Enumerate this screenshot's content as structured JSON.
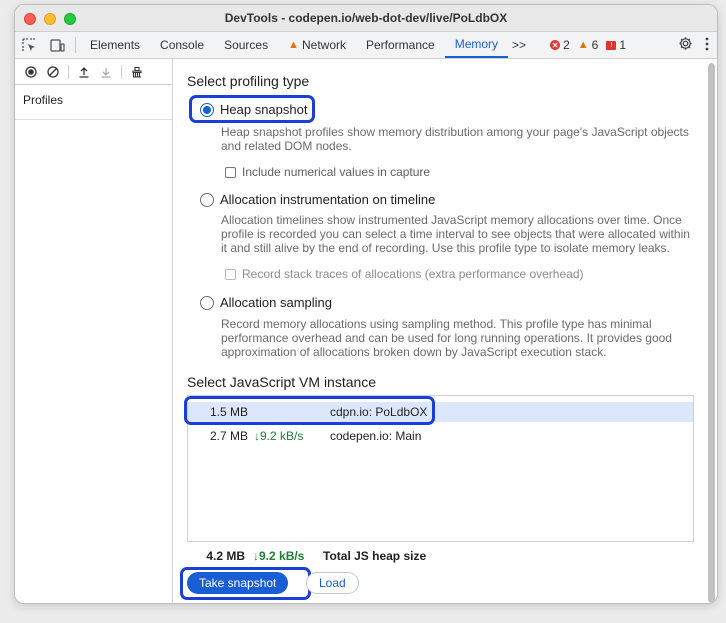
{
  "window": {
    "title": "DevTools - codepen.io/web-dot-dev/live/PoLdbOX"
  },
  "toolbar": {
    "tabs": [
      {
        "label": "Elements"
      },
      {
        "label": "Console"
      },
      {
        "label": "Sources"
      },
      {
        "label": "Network",
        "warning": true
      },
      {
        "label": "Performance"
      },
      {
        "label": "Memory",
        "active": true
      }
    ],
    "more_label": ">>",
    "errors": "2",
    "warnings": "6",
    "issues": "1"
  },
  "sidebar": {
    "section": "Profiles"
  },
  "profiling": {
    "heading": "Select profiling type",
    "options": [
      {
        "label": "Heap snapshot",
        "checked": true,
        "description": "Heap snapshot profiles show memory distribution among your page's JavaScript objects and related DOM nodes.",
        "checkbox": "Include numerical values in capture"
      },
      {
        "label": "Allocation instrumentation on timeline",
        "checked": false,
        "description": "Allocation timelines show instrumented JavaScript memory allocations over time. Once profile is recorded you can select a time interval to see objects that were allocated within it and still alive by the end of recording. Use this profile type to isolate memory leaks.",
        "checkbox": "Record stack traces of allocations (extra performance overhead)"
      },
      {
        "label": "Allocation sampling",
        "checked": false,
        "description": "Record memory allocations using sampling method. This profile type has minimal performance overhead and can be used for long running operations. It provides good approximation of allocations broken down by JavaScript execution stack."
      }
    ]
  },
  "vm": {
    "heading": "Select JavaScript VM instance",
    "instances": [
      {
        "size": "1.5 MB",
        "rate": "",
        "name": "cdpn.io: PoLdbOX",
        "selected": true
      },
      {
        "size": "2.7 MB",
        "rate": "↓9.2 kB/s",
        "name": "codepen.io: Main",
        "selected": false
      }
    ],
    "total": {
      "size": "4.2 MB",
      "rate": "↓9.2 kB/s",
      "label": "Total JS heap size"
    }
  },
  "actions": {
    "take_snapshot": "Take snapshot",
    "load": "Load"
  },
  "colors": {
    "accent": "#1a5ed6",
    "highlight": "#1a3fd6",
    "rate_green": "#1e7e34"
  }
}
